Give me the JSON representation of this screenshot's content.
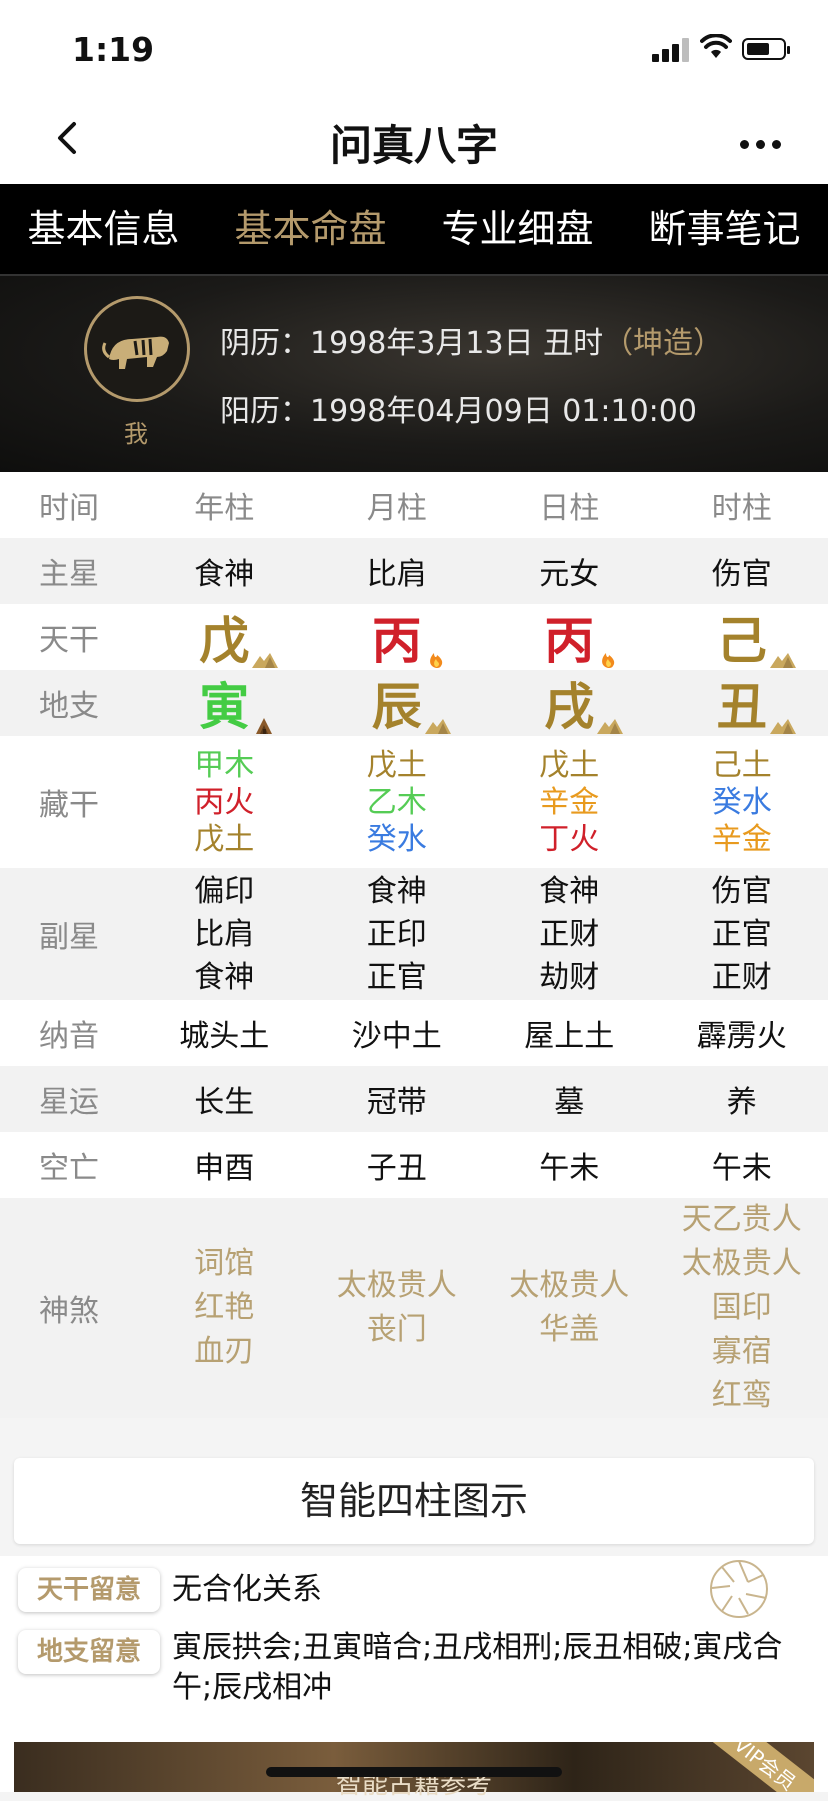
{
  "status": {
    "time": "1:19"
  },
  "nav": {
    "title": "问真八字"
  },
  "tabs": [
    "基本信息",
    "基本命盘",
    "专业细盘",
    "断事笔记"
  ],
  "banner": {
    "me_label": "我",
    "lunar": "阴历：1998年3月13日 丑时",
    "gender_tag": "（坤造）",
    "solar": "阳历：1998年04月09日 01:10:00"
  },
  "table": {
    "header": {
      "label": "时间",
      "cols": [
        "年柱",
        "月柱",
        "日柱",
        "时柱"
      ]
    },
    "main_star": {
      "label": "主星",
      "cols": [
        "食神",
        "比肩",
        "元女",
        "伤官"
      ]
    },
    "heavenly_stem": {
      "label": "天干",
      "cols": [
        {
          "char": "戊",
          "color": "#a4822c",
          "icon": "earth"
        },
        {
          "char": "丙",
          "color": "#d0202a",
          "icon": "fire"
        },
        {
          "char": "丙",
          "color": "#d0202a",
          "icon": "fire"
        },
        {
          "char": "己",
          "color": "#a4822c",
          "icon": "earth"
        }
      ]
    },
    "earthly_branch": {
      "label": "地支",
      "cols": [
        {
          "char": "寅",
          "color": "#44cc44",
          "icon": "wood"
        },
        {
          "char": "辰",
          "color": "#a4822c",
          "icon": "earth"
        },
        {
          "char": "戌",
          "color": "#a4822c",
          "icon": "earth"
        },
        {
          "char": "丑",
          "color": "#a4822c",
          "icon": "earth"
        }
      ]
    },
    "hidden_stems": {
      "label": "藏干",
      "cols": [
        [
          {
            "t": "甲木",
            "c": "#55cc55"
          },
          {
            "t": "丙火",
            "c": "#d0202a"
          },
          {
            "t": "戊土",
            "c": "#a4822c"
          }
        ],
        [
          {
            "t": "戊土",
            "c": "#a4822c"
          },
          {
            "t": "乙木",
            "c": "#55cc55"
          },
          {
            "t": "癸水",
            "c": "#3a7be0"
          }
        ],
        [
          {
            "t": "戊土",
            "c": "#a4822c"
          },
          {
            "t": "辛金",
            "c": "#e89a1e"
          },
          {
            "t": "丁火",
            "c": "#d0202a"
          }
        ],
        [
          {
            "t": "己土",
            "c": "#a4822c"
          },
          {
            "t": "癸水",
            "c": "#3a7be0"
          },
          {
            "t": "辛金",
            "c": "#e89a1e"
          }
        ]
      ]
    },
    "sub_star": {
      "label": "副星",
      "cols": [
        [
          "偏印",
          "比肩",
          "食神"
        ],
        [
          "食神",
          "正印",
          "正官"
        ],
        [
          "食神",
          "正财",
          "劫财"
        ],
        [
          "伤官",
          "正官",
          "正财"
        ]
      ]
    },
    "nayin": {
      "label": "纳音",
      "cols": [
        "城头土",
        "沙中土",
        "屋上土",
        "霹雳火"
      ]
    },
    "star_luck": {
      "label": "星运",
      "cols": [
        "长生",
        "冠带",
        "墓",
        "养"
      ]
    },
    "void": {
      "label": "空亡",
      "cols": [
        "申酉",
        "子丑",
        "午未",
        "午未"
      ]
    },
    "shensha": {
      "label": "神煞",
      "cols": [
        [
          "词馆",
          "红艳",
          "血刃"
        ],
        [
          "太极贵人",
          "丧门"
        ],
        [
          "太极贵人",
          "华盖"
        ],
        [
          "天乙贵人",
          "太极贵人",
          "国印",
          "寡宿",
          "红鸾"
        ]
      ]
    }
  },
  "smart_button": "智能四柱图示",
  "notes": {
    "stem_badge": "天干留意",
    "stem_text": "无合化关系",
    "branch_badge": "地支留意",
    "branch_text_1": "寅辰拱会;丑寅暗合;丑戌相刑;辰丑相破;寅戌合",
    "branch_text_2": "午;辰戌相冲"
  },
  "bottom": {
    "title": "智能古籍参考",
    "vip": "VIP会员"
  }
}
